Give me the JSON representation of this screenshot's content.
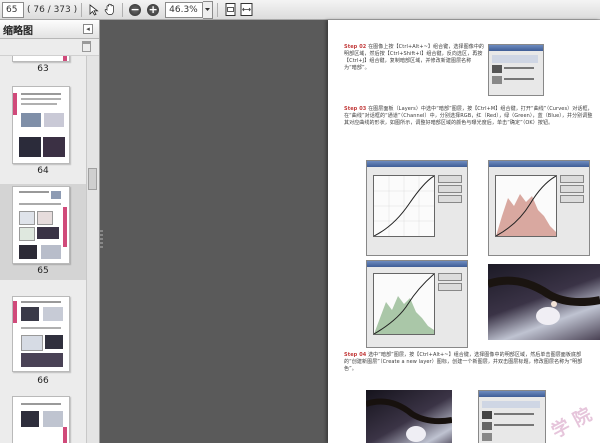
{
  "toolbar": {
    "page_field": "65",
    "page_count": "( 76 / 373 )",
    "zoom": "46.3%"
  },
  "sidebar": {
    "title": "缩略图",
    "pages": [
      {
        "label": "63",
        "selected": false
      },
      {
        "label": "64",
        "selected": false
      },
      {
        "label": "65",
        "selected": true
      },
      {
        "label": "66",
        "selected": false
      }
    ]
  },
  "page": {
    "step2": {
      "head": "Step 02",
      "text": "在图像上按【Ctrl+Alt+~】组合键，选择图像中的明部区域，然后按【Ctrl+Shift+I】组合键，反向选区，再按【Ctrl+J】组合键，复制暗部区域，并修改新建图层名称为“暗部”。"
    },
    "step3": {
      "head": "Step 03",
      "text": "在图层面板（Layers）中选中“暗部”图层，按【Ctrl+M】组合键，打开“曲线”（Curves）对话框，在“曲线”对话框的“通道”（Channel）中，分别选择RGB，红（Red），绿（Green），蓝（Blue），并分别调整其对应曲线的形状，如图所示，调整好暗部区域的颜色与曝光度后，单击“确定”（OK）按钮。"
    },
    "step4": {
      "head": "Step 04",
      "text": "选中“暗部”图层，按【Ctrl+Alt+~】组合键，选择图像中的明部区域，然后单击图层面板底部的“创建新图层”（Create a new layer）图标，创建一个新图层，并双击图层标题，修改图层名称为“明部色”。"
    },
    "watermark": "学 院"
  }
}
